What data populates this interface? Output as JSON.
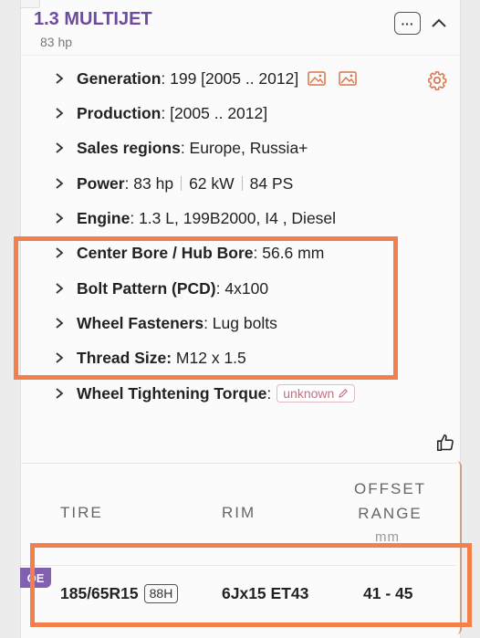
{
  "header": {
    "title": "1.3 MULTIJET",
    "subtitle": "83 hp",
    "more_label": "···"
  },
  "specs": {
    "generation": {
      "label": "Generation",
      "value": ": 199 [2005 .. 2012]"
    },
    "production": {
      "label": "Production",
      "value": ": [2005 .. 2012]"
    },
    "sales_regions": {
      "label": "Sales regions",
      "value": ": Europe, Russia+"
    },
    "power": {
      "label": "Power",
      "value_hp": ": 83 hp",
      "value_kw": "62 kW",
      "value_ps": "84 PS"
    },
    "engine": {
      "label": "Engine",
      "value": ": 1.3 L, 199B2000, I4 , Diesel"
    },
    "center_bore": {
      "label": "Center Bore / Hub Bore",
      "value": ": 56.6 mm"
    },
    "bolt_pattern": {
      "label": "Bolt Pattern (PCD)",
      "value": ": 4x100"
    },
    "wheel_fasteners": {
      "label": "Wheel Fasteners",
      "value": ": Lug bolts"
    },
    "thread_size": {
      "label": "Thread Size:",
      "value": " M12 x 1.5"
    },
    "torque": {
      "label": "Wheel Tightening Torque",
      "value": ":",
      "badge": "unknown"
    }
  },
  "table": {
    "headers": {
      "tire": "TIRE",
      "rim": "RIM",
      "offset_line1": "OFFSET",
      "offset_line2": "RANGE",
      "offset_unit": "mm"
    },
    "rows": [
      {
        "badge": "OE",
        "tire": "185/65R15",
        "load_index": "88H",
        "rim": "6Jx15 ET43",
        "offset": "41 - 45"
      }
    ]
  },
  "icons": {
    "chevron": "chevron-right-icon",
    "image": "image-icon",
    "gear": "gear-icon",
    "pencil": "pencil-icon",
    "thumb": "thumbs-up-icon",
    "collapse": "chevron-up-icon"
  },
  "colors": {
    "title": "#6e4aa0",
    "accent_icon": "#d9744a",
    "highlight": "#f57f4b",
    "oe_badge": "#8260b0",
    "unknown_text": "#c0707f"
  }
}
